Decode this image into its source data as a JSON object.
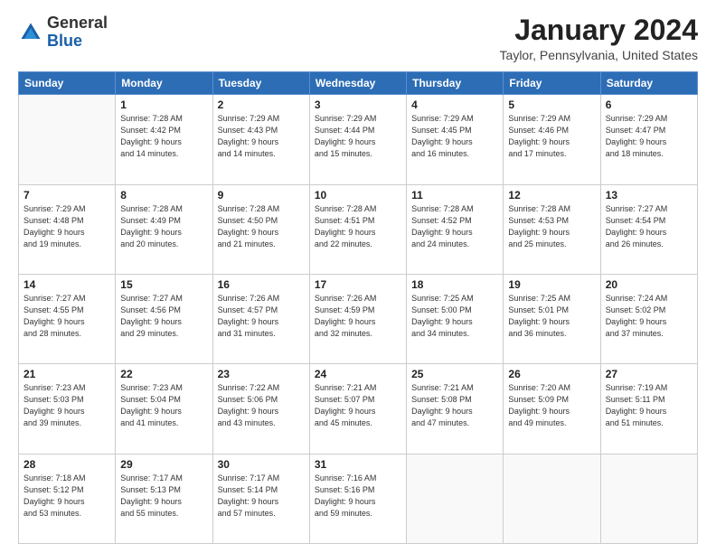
{
  "header": {
    "logo_general": "General",
    "logo_blue": "Blue",
    "month_title": "January 2024",
    "location": "Taylor, Pennsylvania, United States"
  },
  "days_of_week": [
    "Sunday",
    "Monday",
    "Tuesday",
    "Wednesday",
    "Thursday",
    "Friday",
    "Saturday"
  ],
  "weeks": [
    [
      {
        "day": "",
        "info": ""
      },
      {
        "day": "1",
        "info": "Sunrise: 7:28 AM\nSunset: 4:42 PM\nDaylight: 9 hours\nand 14 minutes."
      },
      {
        "day": "2",
        "info": "Sunrise: 7:29 AM\nSunset: 4:43 PM\nDaylight: 9 hours\nand 14 minutes."
      },
      {
        "day": "3",
        "info": "Sunrise: 7:29 AM\nSunset: 4:44 PM\nDaylight: 9 hours\nand 15 minutes."
      },
      {
        "day": "4",
        "info": "Sunrise: 7:29 AM\nSunset: 4:45 PM\nDaylight: 9 hours\nand 16 minutes."
      },
      {
        "day": "5",
        "info": "Sunrise: 7:29 AM\nSunset: 4:46 PM\nDaylight: 9 hours\nand 17 minutes."
      },
      {
        "day": "6",
        "info": "Sunrise: 7:29 AM\nSunset: 4:47 PM\nDaylight: 9 hours\nand 18 minutes."
      }
    ],
    [
      {
        "day": "7",
        "info": "Sunrise: 7:29 AM\nSunset: 4:48 PM\nDaylight: 9 hours\nand 19 minutes."
      },
      {
        "day": "8",
        "info": "Sunrise: 7:28 AM\nSunset: 4:49 PM\nDaylight: 9 hours\nand 20 minutes."
      },
      {
        "day": "9",
        "info": "Sunrise: 7:28 AM\nSunset: 4:50 PM\nDaylight: 9 hours\nand 21 minutes."
      },
      {
        "day": "10",
        "info": "Sunrise: 7:28 AM\nSunset: 4:51 PM\nDaylight: 9 hours\nand 22 minutes."
      },
      {
        "day": "11",
        "info": "Sunrise: 7:28 AM\nSunset: 4:52 PM\nDaylight: 9 hours\nand 24 minutes."
      },
      {
        "day": "12",
        "info": "Sunrise: 7:28 AM\nSunset: 4:53 PM\nDaylight: 9 hours\nand 25 minutes."
      },
      {
        "day": "13",
        "info": "Sunrise: 7:27 AM\nSunset: 4:54 PM\nDaylight: 9 hours\nand 26 minutes."
      }
    ],
    [
      {
        "day": "14",
        "info": "Sunrise: 7:27 AM\nSunset: 4:55 PM\nDaylight: 9 hours\nand 28 minutes."
      },
      {
        "day": "15",
        "info": "Sunrise: 7:27 AM\nSunset: 4:56 PM\nDaylight: 9 hours\nand 29 minutes."
      },
      {
        "day": "16",
        "info": "Sunrise: 7:26 AM\nSunset: 4:57 PM\nDaylight: 9 hours\nand 31 minutes."
      },
      {
        "day": "17",
        "info": "Sunrise: 7:26 AM\nSunset: 4:59 PM\nDaylight: 9 hours\nand 32 minutes."
      },
      {
        "day": "18",
        "info": "Sunrise: 7:25 AM\nSunset: 5:00 PM\nDaylight: 9 hours\nand 34 minutes."
      },
      {
        "day": "19",
        "info": "Sunrise: 7:25 AM\nSunset: 5:01 PM\nDaylight: 9 hours\nand 36 minutes."
      },
      {
        "day": "20",
        "info": "Sunrise: 7:24 AM\nSunset: 5:02 PM\nDaylight: 9 hours\nand 37 minutes."
      }
    ],
    [
      {
        "day": "21",
        "info": "Sunrise: 7:23 AM\nSunset: 5:03 PM\nDaylight: 9 hours\nand 39 minutes."
      },
      {
        "day": "22",
        "info": "Sunrise: 7:23 AM\nSunset: 5:04 PM\nDaylight: 9 hours\nand 41 minutes."
      },
      {
        "day": "23",
        "info": "Sunrise: 7:22 AM\nSunset: 5:06 PM\nDaylight: 9 hours\nand 43 minutes."
      },
      {
        "day": "24",
        "info": "Sunrise: 7:21 AM\nSunset: 5:07 PM\nDaylight: 9 hours\nand 45 minutes."
      },
      {
        "day": "25",
        "info": "Sunrise: 7:21 AM\nSunset: 5:08 PM\nDaylight: 9 hours\nand 47 minutes."
      },
      {
        "day": "26",
        "info": "Sunrise: 7:20 AM\nSunset: 5:09 PM\nDaylight: 9 hours\nand 49 minutes."
      },
      {
        "day": "27",
        "info": "Sunrise: 7:19 AM\nSunset: 5:11 PM\nDaylight: 9 hours\nand 51 minutes."
      }
    ],
    [
      {
        "day": "28",
        "info": "Sunrise: 7:18 AM\nSunset: 5:12 PM\nDaylight: 9 hours\nand 53 minutes."
      },
      {
        "day": "29",
        "info": "Sunrise: 7:17 AM\nSunset: 5:13 PM\nDaylight: 9 hours\nand 55 minutes."
      },
      {
        "day": "30",
        "info": "Sunrise: 7:17 AM\nSunset: 5:14 PM\nDaylight: 9 hours\nand 57 minutes."
      },
      {
        "day": "31",
        "info": "Sunrise: 7:16 AM\nSunset: 5:16 PM\nDaylight: 9 hours\nand 59 minutes."
      },
      {
        "day": "",
        "info": ""
      },
      {
        "day": "",
        "info": ""
      },
      {
        "day": "",
        "info": ""
      }
    ]
  ]
}
